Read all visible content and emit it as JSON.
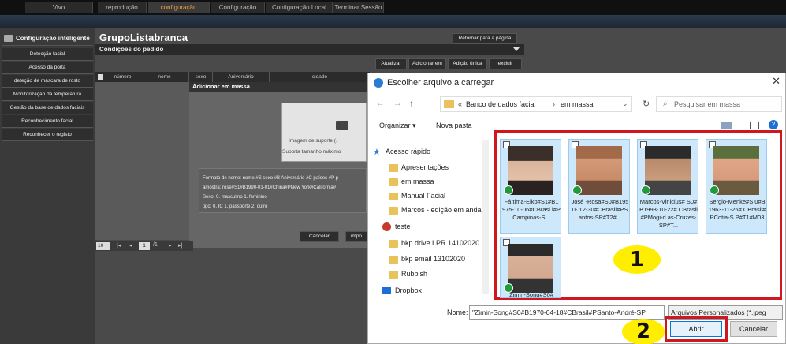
{
  "topnav": {
    "tabs": [
      {
        "label": "Vivo"
      },
      {
        "label": "reprodução"
      },
      {
        "label": "configuração"
      },
      {
        "label": "Configuração"
      },
      {
        "label": "Configuração Local"
      },
      {
        "label": "Terminar Sessão"
      }
    ],
    "active_color": "#f0a040"
  },
  "sidebar": {
    "header": "Configuração inteligente",
    "items": [
      {
        "label": "Detecção facial"
      },
      {
        "label": "Acesso da porta"
      },
      {
        "label": "deteção de máscara de rosto"
      },
      {
        "label": "Monitorização da temperatura"
      },
      {
        "label": "Gestão da base de dados faciais"
      },
      {
        "label": "Reconhecimento facial"
      },
      {
        "label": "Reconhecer o registo"
      }
    ]
  },
  "main": {
    "title": "GrupoListabranca",
    "return_button": "Retornar para a página",
    "conditions": "Condições do pedido",
    "actions": [
      "Atualizar",
      "Adicionar em",
      "Adição única",
      "excluir"
    ],
    "columns": [
      "número",
      "nome",
      "sexo",
      "Aniversário",
      "cidade"
    ],
    "pager": {
      "page_size": "10",
      "page": "1",
      "of": "/1"
    }
  },
  "modal": {
    "title": "Adicionar em massa",
    "upload_line1": "Imagem de suporte (.",
    "upload_line2": "Suporta tamanho máximo",
    "format_lines": [
      "Formato de nome: nome #S sexo #B Aniversário #C países #P p",
      "amostra: rose#S1#B1990-01-01#China#PNew York#California#",
      "Sexo: 0. masculino 1. feminino",
      "tipo: 0. IC 1. passporte 2. outro"
    ],
    "cancel": "Cancelar",
    "import": "impo"
  },
  "dialog": {
    "title": "Escolher arquivo a carregar",
    "breadcrumb": [
      "Banco de dados facial",
      "em massa"
    ],
    "search_placeholder": "Pesquisar em massa",
    "organize": "Organizar ▾",
    "new_folder": "Nova pasta",
    "nav": [
      "Acesso rápido",
      "Apresentações",
      "em massa",
      "Manual Facial",
      "Marcos - edição em andan",
      "teste",
      "bkp drive LPR 14102020",
      "bkp email 13102020",
      "Rubbish",
      "Dropbox"
    ],
    "files": [
      {
        "name": "Fá tima-Eiko#S1#B1 975-10-06#CBrasi l#PCampinas-S..."
      },
      {
        "name": "José -Rosa#S0#B1950- 12-30#CBrasil#PS antos-SP#T2#..."
      },
      {
        "name": "Marcos-Vinicius# S0#B1993-10-22# CBrasil#PMogi-d as-Cruzes-SP#T..."
      },
      {
        "name": "Sergio-Menke#S 0#B1963-11-25# CBrasil#PCotia-S P#T1#M03"
      },
      {
        "name": "Zimin-Song#S0#"
      }
    ],
    "name_label": "Nome:",
    "name_value": "\"Zimin-Song#S0#B1970-04-18#CBrasil#PSanto-André-SP",
    "file_type": "Arquivos Personalizados (*.jpeg",
    "open": "Abrir",
    "cancel": "Cancelar",
    "callout_1": "1",
    "callout_2": "2",
    "highlight_color": "#d0161e",
    "callout_color": "#ffee00"
  }
}
